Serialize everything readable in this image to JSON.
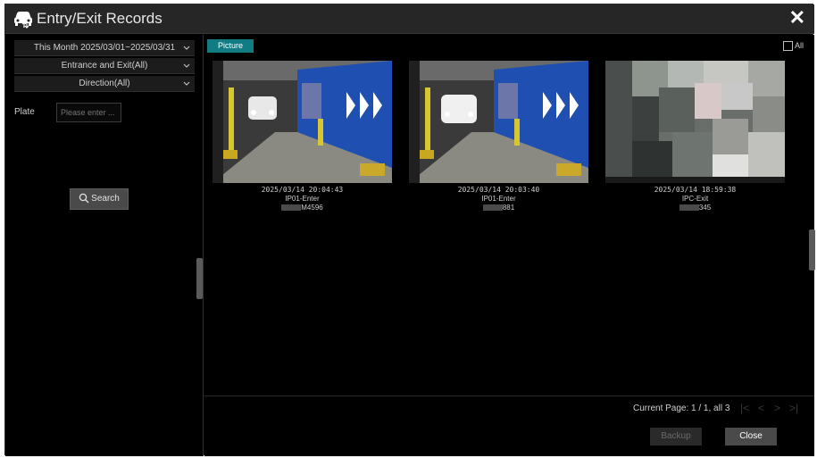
{
  "window": {
    "title": "Entry/Exit Records",
    "close_label": "✕"
  },
  "filters": {
    "date_range": "This Month 2025/03/01~2025/03/31",
    "event_type": "Entrance and Exit(All)",
    "direction": "Direction(All)",
    "plate_label": "Plate",
    "plate_placeholder": "Please enter ...",
    "search_label": "Search"
  },
  "view": {
    "tab_label": "Picture",
    "all_label": "All",
    "all_checked": false
  },
  "records": [
    {
      "timestamp": "2025/03/14 20:04:43",
      "camera": "IP01-Enter",
      "plate_suffix": "M4596"
    },
    {
      "timestamp": "2025/03/14 20:03:40",
      "camera": "IP01-Enter",
      "plate_suffix": "881"
    },
    {
      "timestamp": "2025/03/14 18:59:38",
      "camera": "IPC-Exit",
      "plate_suffix": "345"
    }
  ],
  "footer": {
    "page_info": "Current Page: 1 / 1, all 3",
    "backup_label": "Backup",
    "close_label": "Close"
  },
  "colors": {
    "accent": "#127c84",
    "background": "#000000",
    "titlebar": "#262626"
  }
}
